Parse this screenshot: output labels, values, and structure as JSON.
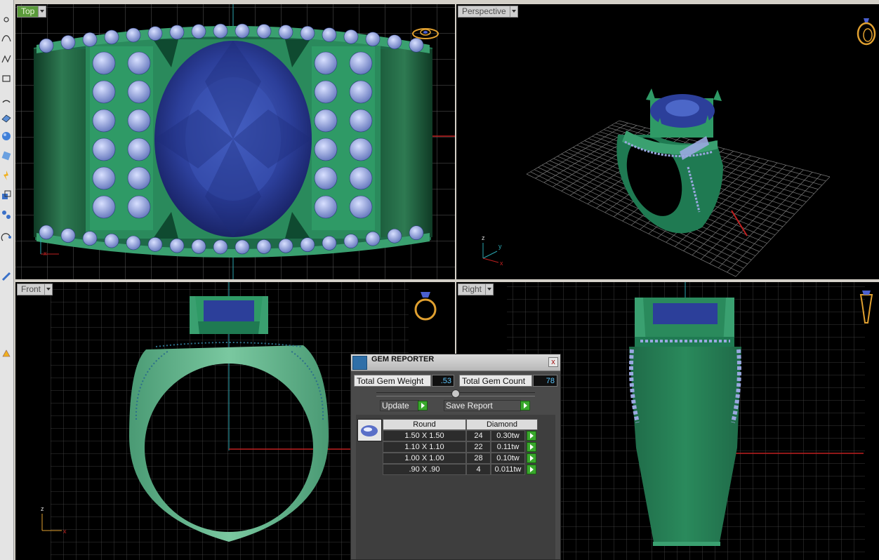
{
  "viewports": {
    "top": {
      "label": "Top"
    },
    "perspective": {
      "label": "Perspective"
    },
    "front": {
      "label": "Front"
    },
    "right": {
      "label": "Right"
    }
  },
  "axes": {
    "x": "x",
    "y": "y",
    "z": "z"
  },
  "gem_reporter": {
    "title": "GEM REPORTER",
    "close": "x",
    "total_weight_label": "Total Gem Weight",
    "total_weight_value": ".53",
    "total_count_label": "Total Gem Count",
    "total_count_value": "78",
    "update_label": "Update",
    "save_report_label": "Save Report",
    "table": {
      "headers": [
        "Round",
        "Diamond"
      ],
      "rows": [
        {
          "size": "1.50 X 1.50",
          "count": "24",
          "weight": "0.30tw"
        },
        {
          "size": "1.10 X 1.10",
          "count": "22",
          "weight": "0.11tw"
        },
        {
          "size": "1.00 X 1.00",
          "count": "28",
          "weight": "0.10tw"
        },
        {
          "size": ".90 X .90",
          "count": "4",
          "weight": "0.011tw"
        }
      ]
    }
  },
  "colors": {
    "metal": "#2e8a5a",
    "metal_light": "#7ac8a0",
    "stone": "#2c3f9a",
    "accent_gem": "#9aa8e0",
    "ring_icon": "#e0a030",
    "tab_active": "#5a9a3a",
    "value_text": "#5ec8ff"
  },
  "icons": {
    "toolbar": [
      "point-icon",
      "curve-icon",
      "polyline-icon",
      "rectangle-icon",
      "arc-icon",
      "surface-icon",
      "sphere-icon",
      "extrude-icon",
      "fillet-icon",
      "boolean-icon",
      "transform-icon",
      "analyze-icon",
      "dimension-icon",
      "render-icon"
    ],
    "viewport_ring": "ring-icon",
    "gem_thumb": "gem-icon"
  }
}
